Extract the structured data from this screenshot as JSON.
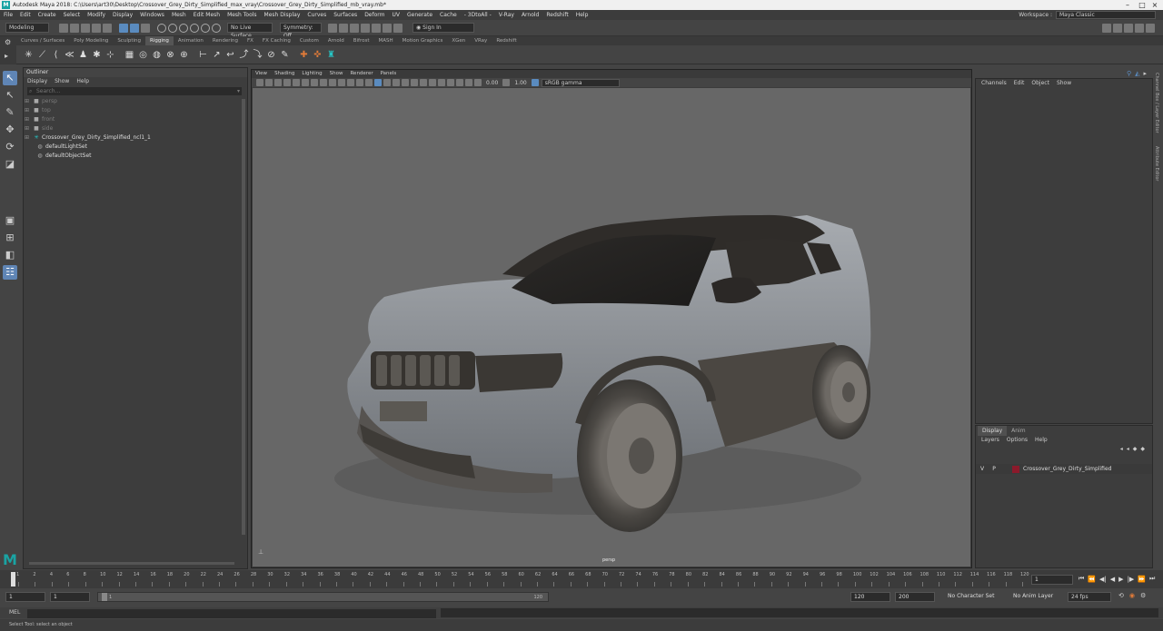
{
  "window": {
    "title": "Autodesk Maya 2018: C:\\Users\\art30\\Desktop\\Crossover_Grey_Dirty_Simplified_max_vray\\Crossover_Grey_Dirty_Simplified_mb_vray.mb*"
  },
  "menu_bar": {
    "items": [
      "File",
      "Edit",
      "Create",
      "Select",
      "Modify",
      "Display",
      "Windows",
      "Mesh",
      "Edit Mesh",
      "Mesh Tools",
      "Mesh Display",
      "Curves",
      "Surfaces",
      "Deform",
      "UV",
      "Generate",
      "Cache",
      "- 3DtoAll -",
      "V-Ray",
      "Arnold",
      "Redshift",
      "Help"
    ],
    "workspace_label": "Workspace :",
    "workspace_value": "Maya Classic"
  },
  "status_line": {
    "mode": "Modeling",
    "live_surface": "No Live Surface",
    "symmetry": "Symmetry: Off",
    "sign_in": "Sign In"
  },
  "shelf": {
    "tabs": [
      "Curves / Surfaces",
      "Poly Modeling",
      "Sculpting",
      "Rigging",
      "Animation",
      "Rendering",
      "FX",
      "FX Caching",
      "Custom",
      "Arnold",
      "Bifrost",
      "MASH",
      "Motion Graphics",
      "XGen",
      "VRay",
      "Redshift"
    ],
    "active_tab": "Rigging"
  },
  "outliner": {
    "title": "Outliner",
    "menus": [
      "Display",
      "Show",
      "Help"
    ],
    "search_placeholder": "Search...",
    "items": [
      {
        "label": "persp",
        "icon": "camera-icon",
        "dim": true
      },
      {
        "label": "top",
        "icon": "camera-icon",
        "dim": true
      },
      {
        "label": "front",
        "icon": "camera-icon",
        "dim": true
      },
      {
        "label": "side",
        "icon": "camera-icon",
        "dim": true
      },
      {
        "label": "Crossover_Grey_Dirty_Simplified_ncl1_1",
        "icon": "group-icon",
        "dim": false
      },
      {
        "label": "defaultLightSet",
        "icon": "set-icon",
        "dim": false
      },
      {
        "label": "defaultObjectSet",
        "icon": "set-icon",
        "dim": false
      }
    ]
  },
  "viewport": {
    "menus": [
      "View",
      "Shading",
      "Lighting",
      "Show",
      "Renderer",
      "Panels"
    ],
    "near_value": "0.00",
    "gamma_value": "1.00",
    "color_space": "sRGB gamma",
    "camera": "persp"
  },
  "channel_box": {
    "menus": [
      "Channels",
      "Edit",
      "Object",
      "Show"
    ]
  },
  "side_tabs": [
    "Channel Box / Layer Editor",
    "Attribute Editor"
  ],
  "layer_editor": {
    "tabs": [
      "Display",
      "Anim"
    ],
    "menus": [
      "Layers",
      "Options",
      "Help"
    ],
    "layers": [
      {
        "v": "V",
        "p": "P",
        "name": "Crossover_Grey_Dirty_Simplified",
        "color": "#8b1a2b"
      }
    ]
  },
  "time_slider": {
    "ticks": [
      "1",
      "2",
      "4",
      "6",
      "8",
      "10",
      "12",
      "14",
      "16",
      "18",
      "20",
      "22",
      "24",
      "26",
      "28",
      "30",
      "32",
      "34",
      "36",
      "38",
      "40",
      "42",
      "44",
      "46",
      "48",
      "50",
      "52",
      "54",
      "56",
      "58",
      "60",
      "62",
      "64",
      "66",
      "68",
      "70",
      "72",
      "74",
      "76",
      "78",
      "80",
      "82",
      "84",
      "86",
      "88",
      "90",
      "92",
      "94",
      "96",
      "98",
      "100",
      "102",
      "104",
      "106",
      "108",
      "110",
      "112",
      "114",
      "116",
      "118",
      "120"
    ],
    "current_frame": "1"
  },
  "range_slider": {
    "start": "1",
    "start_inner": "1",
    "bar_start": "1",
    "bar_end": "120",
    "end_inner": "120",
    "end": "200",
    "character_set": "No Character Set",
    "anim_layer": "No Anim Layer",
    "fps": "24 fps"
  },
  "command_line": {
    "label": "MEL"
  },
  "help_line": {
    "text": "Select Tool: select an object"
  }
}
